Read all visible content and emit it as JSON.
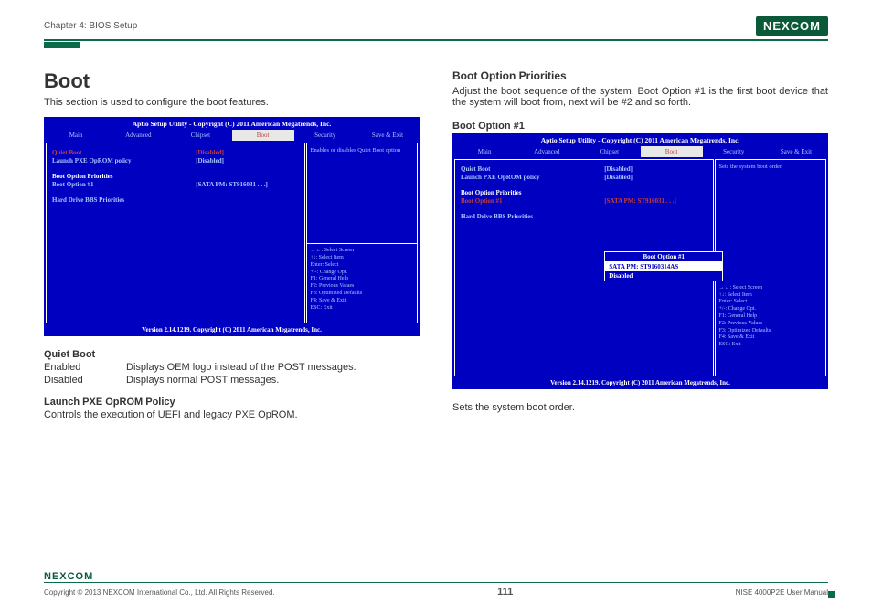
{
  "header": {
    "chapter": "Chapter 4: BIOS Setup",
    "logo": "NEXCOM"
  },
  "left": {
    "title": "Boot",
    "intro": "This section is used to configure the boot features.",
    "bios": {
      "title": "Aptio Setup Utility - Copyright (C) 2011 American Megatrends, Inc.",
      "tabs": [
        "Main",
        "Advanced",
        "Chipset",
        "Boot",
        "Security",
        "Save & Exit"
      ],
      "rows": {
        "quiet_l": "Quiet Boot",
        "quiet_v": "[Disabled]",
        "pxe_l": "Launch PXE OpROM policy",
        "pxe_v": "[Disabled]",
        "bop": "Boot Option Priorities",
        "bo1_l": "Boot Option #1",
        "bo1_v": "[SATA PM: ST916031 . . .]",
        "hbbs": "Hard Drive BBS Priorities"
      },
      "help": "Enables or disables Quiet Boot option",
      "keys": [
        "→←: Select Screen",
        "↑↓: Select Item",
        "Enter: Select",
        "+/-: Change Opt.",
        "F1: General Help",
        "F2: Previous Values",
        "F3: Optimized Defaults",
        "F4: Save & Exit",
        "ESC: Exit"
      ],
      "footer": "Version 2.14.1219. Copyright (C) 2011 American Megatrends, Inc."
    },
    "qb_h": "Quiet Boot",
    "qb_en_k": "Enabled",
    "qb_en_v": "Displays OEM logo instead of the POST messages.",
    "qb_dis_k": "Disabled",
    "qb_dis_v": "Displays normal POST messages.",
    "pxe_h": "Launch PXE OpROM Policy",
    "pxe_d": "Controls the execution of UEFI and legacy PXE OpROM."
  },
  "right": {
    "title": "Boot Option Priorities",
    "desc": "Adjust the boot sequence of the system. Boot Option #1 is the first boot device that the system will boot from, next will be #2 and so forth.",
    "bo1_h": "Boot Option #1",
    "bios": {
      "title": "Aptio Setup Utility - Copyright (C) 2011 American Megatrends, Inc.",
      "tabs": [
        "Main",
        "Advanced",
        "Chipset",
        "Boot",
        "Security",
        "Save & Exit"
      ],
      "rows": {
        "quiet_l": "Quiet Boot",
        "quiet_v": "[Disabled]",
        "pxe_l": "Launch PXE OpROM policy",
        "pxe_v": "[Disabled]",
        "bop": "Boot Option Priorities",
        "bo1_l": "Boot Option #1",
        "bo1_v": "[SATA PM: ST916031 . . .]",
        "hbbs": "Hard Drive BBS Priorities"
      },
      "help": "Sets the system boot order",
      "popup_title": "Boot Option #1",
      "popup_item1": "SATA PM: ST9160314AS",
      "popup_item2": "Disabled",
      "keys": [
        "→←: Select Screen",
        "↑↓: Select Item",
        "Enter: Select",
        "+/-: Change Opt.",
        "F1: General Help",
        "F2: Previous Values",
        "F3: Optimized Defaults",
        "F4: Save & Exit",
        "ESC: Exit"
      ],
      "footer": "Version 2.14.1219. Copyright (C) 2011 American Megatrends, Inc."
    },
    "after": "Sets the system boot order."
  },
  "footer": {
    "logo": "NEXCOM",
    "copyright": "Copyright © 2013 NEXCOM International Co., Ltd. All Rights Reserved.",
    "page": "111",
    "manual": "NISE 4000P2E User Manual"
  }
}
